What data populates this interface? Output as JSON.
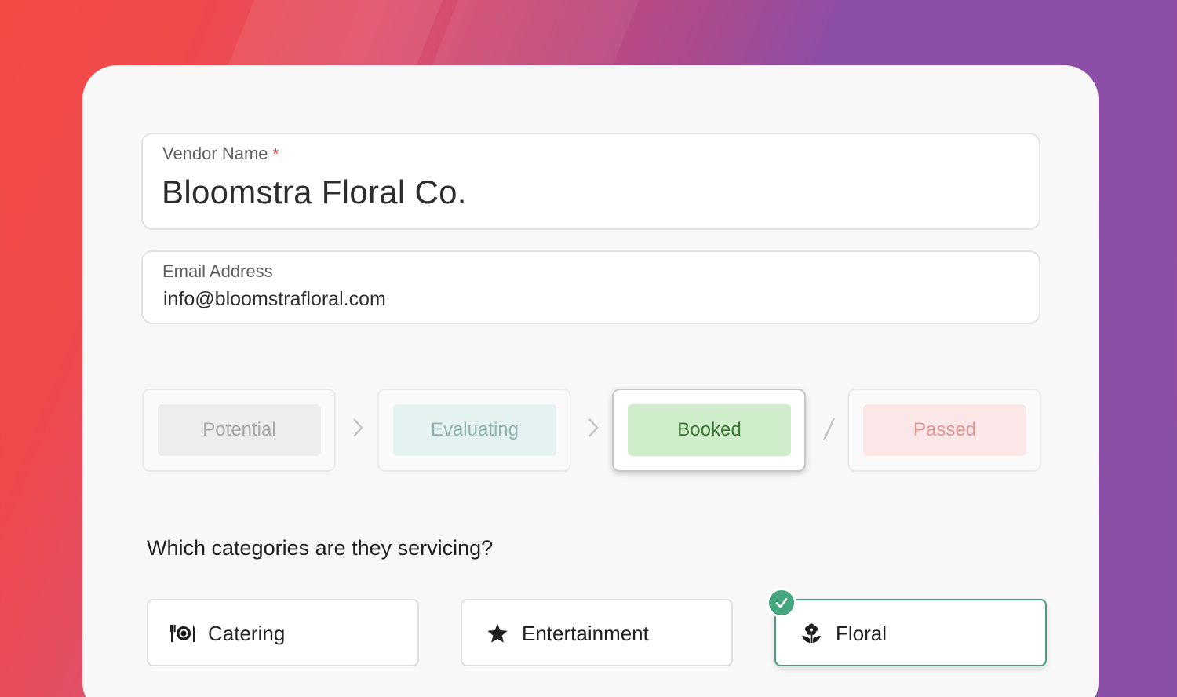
{
  "vendor_name": {
    "label": "Vendor Name",
    "required_marker": "*",
    "value": "Bloomstra Floral Co."
  },
  "email": {
    "label": "Email Address",
    "value": "info@bloomstrafloral.com"
  },
  "status": {
    "selected": "Booked",
    "options": [
      {
        "label": "Potential",
        "bg": "#ededed",
        "color": "#a8a8a8"
      },
      {
        "label": "Evaluating",
        "bg": "#e4f2f2",
        "color": "#93b4b4"
      },
      {
        "label": "Booked",
        "bg": "#cfeccb",
        "color": "#3b7a33"
      },
      {
        "label": "Passed",
        "bg": "#fbe7e7",
        "color": "#e09595"
      }
    ],
    "separators": [
      ">",
      ">",
      "/"
    ]
  },
  "categories": {
    "question": "Which categories are they servicing?",
    "items": [
      {
        "label": "Catering",
        "icon": "utensils-plate-icon",
        "selected": false
      },
      {
        "label": "Entertainment",
        "icon": "star-icon",
        "selected": false
      },
      {
        "label": "Floral",
        "icon": "flower-icon",
        "selected": true
      }
    ]
  },
  "colors": {
    "accent_green": "#45a57f",
    "required_red": "#e0413a"
  }
}
